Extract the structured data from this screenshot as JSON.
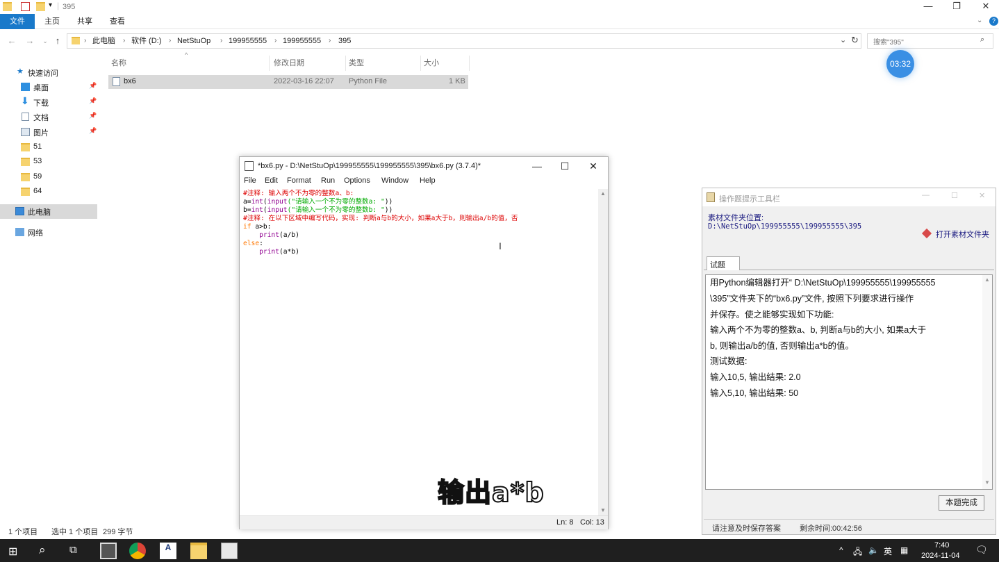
{
  "explorer": {
    "title": "395",
    "tabs": [
      "文件",
      "主页",
      "共享",
      "查看"
    ],
    "breadcrumb": [
      "此电脑",
      "软件 (D:)",
      "NetStuOp",
      "199955555",
      "199955555",
      "395"
    ],
    "search_placeholder": "搜索\"395\"",
    "sidebar": {
      "quick_access": "快速访问",
      "items": [
        {
          "label": "桌面",
          "pinned": true
        },
        {
          "label": "下载",
          "pinned": true
        },
        {
          "label": "文档",
          "pinned": true
        },
        {
          "label": "图片",
          "pinned": true
        },
        {
          "label": "51",
          "pinned": false
        },
        {
          "label": "53",
          "pinned": false
        },
        {
          "label": "59",
          "pinned": false
        },
        {
          "label": "64",
          "pinned": false
        }
      ],
      "this_pc": "此电脑",
      "network": "网络"
    },
    "columns": [
      "名称",
      "修改日期",
      "类型",
      "大小"
    ],
    "file": {
      "name": "bx6",
      "date": "2022-03-16 22:07",
      "type": "Python File",
      "size": "1 KB"
    },
    "status": {
      "count": "1 个项目",
      "selected": "选中 1 个项目",
      "bytes": "299 字节"
    }
  },
  "timer_bubble": "03:32",
  "idle": {
    "title": "*bx6.py - D:\\NetStuOp\\199955555\\199955555\\395\\bx6.py (3.7.4)*",
    "menu": [
      "File",
      "Edit",
      "Format",
      "Run",
      "Options",
      "Window",
      "Help"
    ],
    "code": {
      "l1": "#注释: 输入两个不为零的整数a、b:",
      "l2_pre": "a=",
      "l2_int": "int",
      "l2_open": "(",
      "l2_input": "input",
      "l2_str": "(\"请输入一个不为零的整数a: \"",
      "l2_close": "))",
      "l3_pre": "b=",
      "l3_int": "int",
      "l3_open": "(",
      "l3_input": "input",
      "l3_str": "(\"请输入一个不为零的整数b: \"",
      "l3_close": "))",
      "l4": "#注释: 在以下区域中编写代码，实现: 判断a与b的大小，如果a大于b，则输出a/b的值，否",
      "l5_kw": "if",
      "l5_rest": " a>b:",
      "l6_indent": "    ",
      "l6_fn": "print",
      "l6_rest": "(a/b)",
      "l7_kw": "else",
      "l7_rest": ":",
      "l8_indent": "    ",
      "l8_fn": "print",
      "l8_rest": "(a*b)"
    },
    "status_ln": "Ln: 8",
    "status_col": "Col: 13"
  },
  "subtitle": "输出a*b",
  "tool": {
    "title": "操作题提示工具栏",
    "path_label": "素材文件夹位置:",
    "path": "D:\\NetStuOp\\199955555\\199955555\\395",
    "open_folder": "打开素材文件夹",
    "tab": "试题",
    "question_lines": [
      "用Python编辑器打开“ D:\\NetStuOp\\199955555\\199955555",
      "\\395”文件夹下的“bx6.py”文件, 按照下列要求进行操作",
      "并保存。使之能够实现如下功能:",
      "输入两个不为零的整数a、b, 判断a与b的大小, 如果a大于",
      "b, 则输出a/b的值, 否则输出a*b的值。",
      "测试数据:",
      "输入10,5, 输出结果: 2.0",
      "输入5,10, 输出结果: 50"
    ],
    "done_button": "本题完成",
    "save_notice": "请注意及时保存答案",
    "time_left": "剩余时间:00:42:56"
  },
  "taskbar": {
    "ime": "英",
    "time": "7:40",
    "date": "2024-11-04"
  }
}
